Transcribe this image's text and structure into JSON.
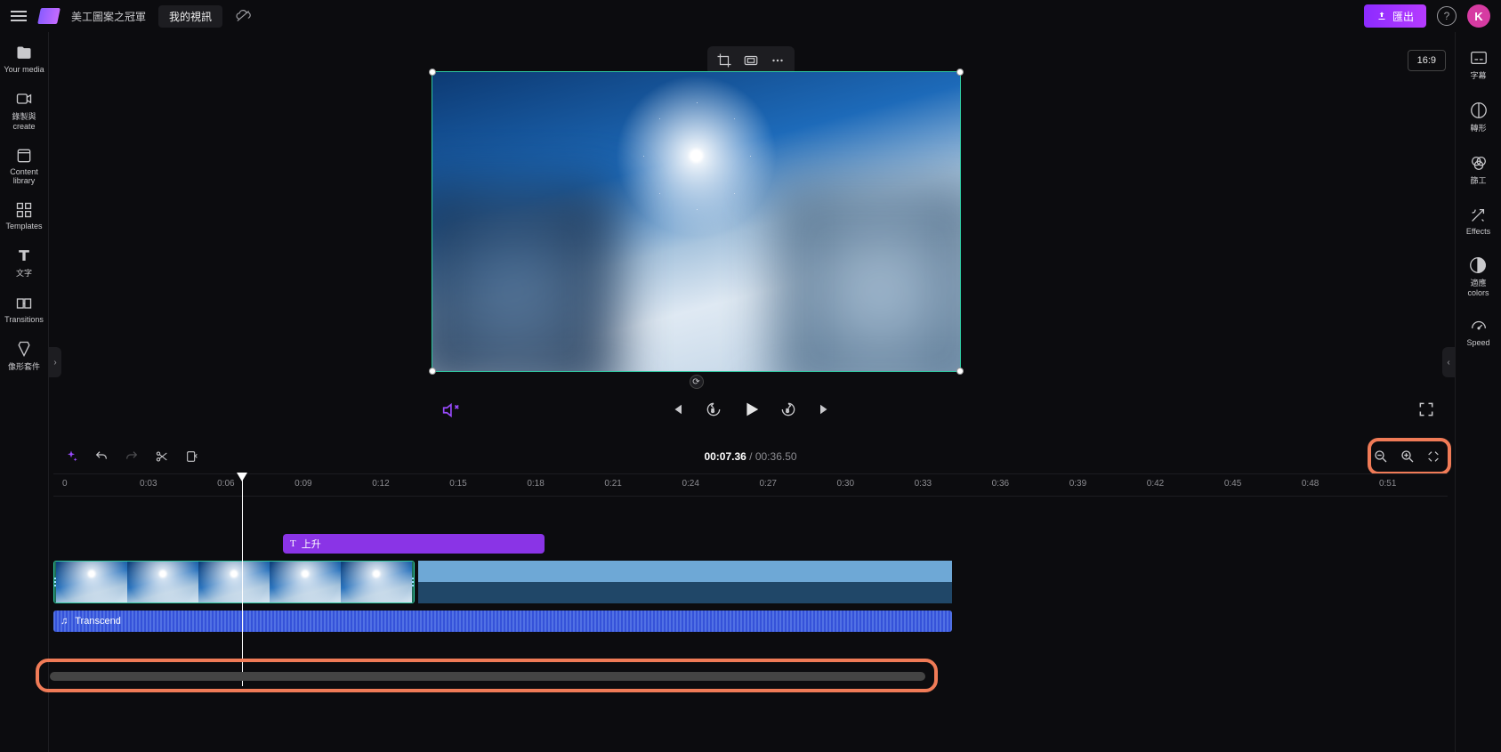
{
  "topbar": {
    "project_title": "美工圖案之冠軍",
    "project_sub": "我的視訊",
    "export_label": "匯出",
    "avatar_letter": "K"
  },
  "left_sidebar": [
    {
      "label": "Your media",
      "name": "sidebar-your-media"
    },
    {
      "label": "錄製與\ncreate",
      "name": "sidebar-record-create"
    },
    {
      "label": "Content\nlibrary",
      "name": "sidebar-content-library"
    },
    {
      "label": "Templates",
      "name": "sidebar-templates"
    },
    {
      "label": "文字",
      "name": "sidebar-text"
    },
    {
      "label": "Transitions",
      "name": "sidebar-transitions"
    },
    {
      "label": "像形套件",
      "name": "sidebar-brand-kit"
    }
  ],
  "right_sidebar": [
    {
      "label": "字幕",
      "name": "right-subtitles"
    },
    {
      "label": "轉形",
      "name": "right-transform"
    },
    {
      "label": "篩工",
      "name": "right-filters"
    },
    {
      "label": "Effects",
      "name": "right-effects"
    },
    {
      "label": "適應\ncolors",
      "name": "right-adjust-colors"
    },
    {
      "label": "Speed",
      "name": "right-speed"
    }
  ],
  "aspect_ratio": "16:9",
  "time": {
    "current": "00:07.36",
    "duration": "00:36.50",
    "sep": " / "
  },
  "ruler_ticks": [
    "0",
    "0:03",
    "0:06",
    "0:09",
    "0:12",
    "0:15",
    "0:18",
    "0:21",
    "0:24",
    "0:27",
    "0:30",
    "0:33",
    "0:36",
    "0:39",
    "0:42",
    "0:45",
    "0:48",
    "0:51"
  ],
  "title_clip": {
    "label": "上升"
  },
  "audio_clip": {
    "label": "Transcend"
  }
}
